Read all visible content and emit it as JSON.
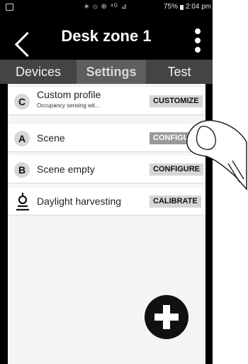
{
  "status_bar": {
    "signal_glyphs": "∗ ⦸ ⊕ ⁴ᴳ ⊿",
    "battery_percent": "75%",
    "time": "2:04 pm"
  },
  "header": {
    "title": "Desk zone 1"
  },
  "tabs": [
    {
      "label": "Devices"
    },
    {
      "label": "Settings"
    },
    {
      "label": "Test"
    }
  ],
  "rows": [
    {
      "badge": "C",
      "label": "Custom profile",
      "sub": "Occupancy sensing wit...",
      "action": "CUSTOMIZE"
    },
    {
      "badge": "A",
      "label": "Scene",
      "action": "CONFIGURE"
    },
    {
      "badge": "B",
      "label": "Scene empty",
      "action": "CONFIGURE"
    },
    {
      "icon": "daylight-sensor-icon",
      "label": "Daylight harvesting",
      "action": "CALIBRATE"
    }
  ],
  "colors": {
    "header_bg": "#000000",
    "tab_bar_bg": "#444444",
    "active_tab_bg": "#5e5e5e",
    "button_bg": "#d6d6d6",
    "fab_bg": "#111111"
  }
}
